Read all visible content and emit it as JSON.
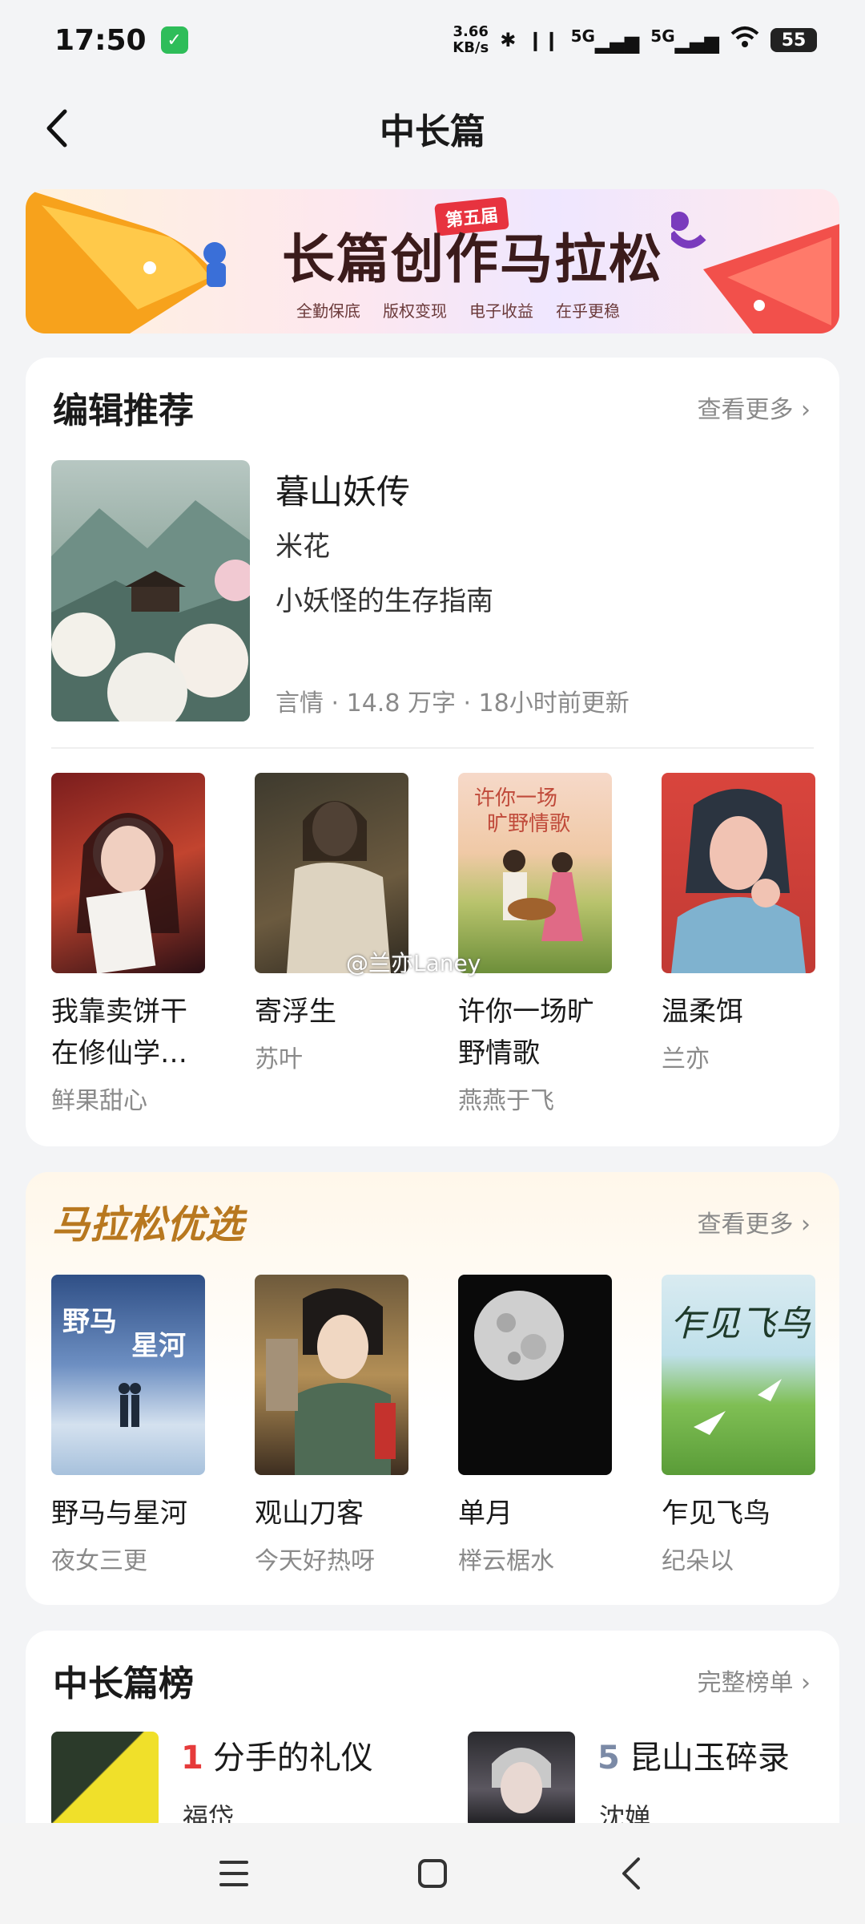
{
  "status": {
    "time": "17:50",
    "net_speed_value": "3.66",
    "net_speed_unit": "KB/s",
    "sig1": "5G",
    "sig2": "5G",
    "battery": "55"
  },
  "header": {
    "title": "中长篇"
  },
  "banner": {
    "badge": "第五届",
    "title": "长篇创作马拉松",
    "tags": [
      "全勤保底",
      "版权变现",
      "电子收益",
      "在乎更稳"
    ]
  },
  "editor": {
    "title": "编辑推荐",
    "more": "查看更多 ›",
    "featured": {
      "title": "暮山妖传",
      "author": "米花",
      "desc": "小妖怪的生存指南",
      "meta": "言情 · 14.8 万字 · 18小时前更新"
    },
    "books": [
      {
        "title": "我靠卖饼干在修仙学…",
        "author": "鲜果甜心"
      },
      {
        "title": "寄浮生",
        "author": "苏叶"
      },
      {
        "title": "许你一场旷野情歌",
        "author": "燕燕于飞"
      },
      {
        "title": "温柔饵",
        "author": "兰亦"
      }
    ]
  },
  "marathon": {
    "title": "马拉松优选",
    "more": "查看更多 ›",
    "books": [
      {
        "title": "野马与星河",
        "author": "夜女三更"
      },
      {
        "title": "观山刀客",
        "author": "今天好热呀"
      },
      {
        "title": "单月",
        "author": "榉云椐水"
      },
      {
        "title": "乍见飞鸟",
        "author": "纪朵以"
      }
    ]
  },
  "ranking": {
    "title": "中长篇榜",
    "more": "完整榜单 ›",
    "items": [
      {
        "rank": "1",
        "title": "分手的礼仪",
        "author": "福岱",
        "rank_color": "#e63b3b"
      },
      {
        "rank": "5",
        "title": "昆山玉碎录",
        "author": "沈婵",
        "rank_color": "#7b8aa6"
      }
    ]
  },
  "watermark": "@兰亦Laney"
}
